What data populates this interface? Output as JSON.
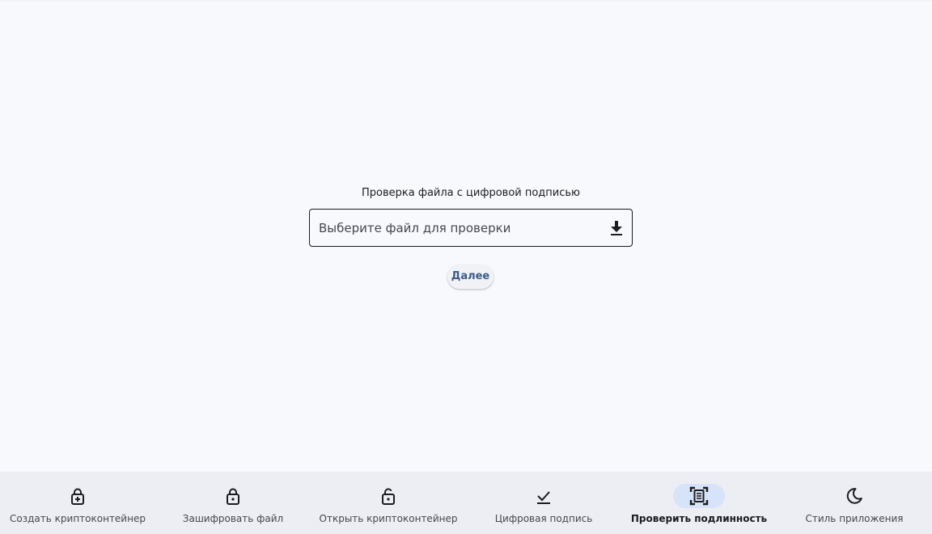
{
  "form": {
    "title": "Проверка файла с цифровой подписью",
    "file_placeholder": "Выберите файл для проверки",
    "file_icon": "download-icon",
    "next_label": "Далее"
  },
  "nav": {
    "active_index": 4,
    "items": [
      {
        "label": "Создать криптоконтейнер",
        "icon": "lock-plus-icon"
      },
      {
        "label": "Зашифровать файл",
        "icon": "lock-icon"
      },
      {
        "label": "Открыть криптоконтейнер",
        "icon": "lock-open-icon"
      },
      {
        "label": "Цифровая подпись",
        "icon": "check-icon"
      },
      {
        "label": "Проверить подлинность",
        "icon": "document-scan-icon"
      },
      {
        "label": "Стиль приложения",
        "icon": "moon-icon"
      }
    ]
  },
  "colors": {
    "background": "#f8f9fd",
    "navbar": "#edeef3",
    "active_indicator": "#d7e3f8",
    "accent_text": "#3a5a88"
  }
}
